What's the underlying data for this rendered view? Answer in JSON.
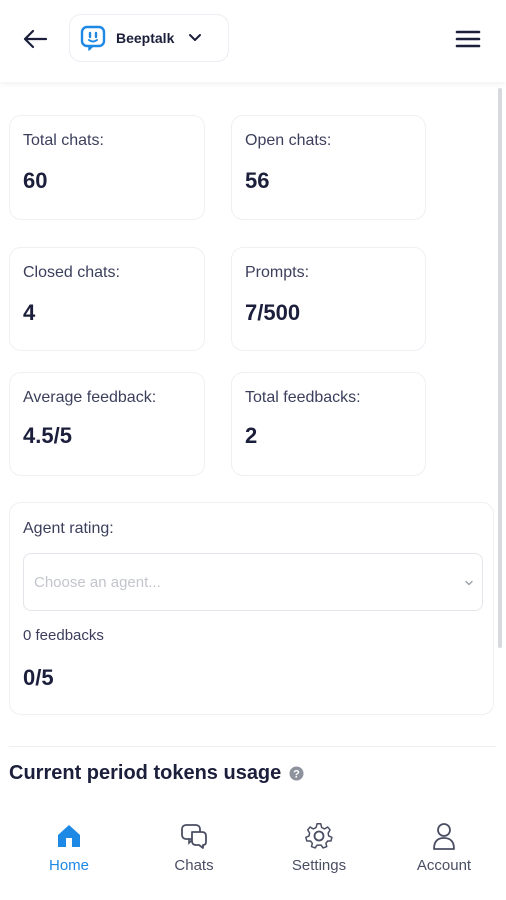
{
  "header": {
    "workspace_name": "Beeptalk"
  },
  "stats": [
    {
      "label": "Total chats:",
      "value": "60"
    },
    {
      "label": "Open chats:",
      "value": "56"
    },
    {
      "label": "Closed chats:",
      "value": "4"
    },
    {
      "label": "Prompts:",
      "value": "7/500"
    },
    {
      "label": "Average feedback:",
      "value": "4.5/5"
    },
    {
      "label": "Total feedbacks:",
      "value": "2"
    }
  ],
  "agent_rating": {
    "label": "Agent rating:",
    "select_placeholder": "Choose an agent...",
    "feedbacks_text": "0 feedbacks",
    "score": "0/5"
  },
  "tokens_section": {
    "title": "Current period tokens usage"
  },
  "nav": {
    "items": [
      {
        "label": "Home",
        "icon": "home-icon",
        "active": true
      },
      {
        "label": "Chats",
        "icon": "chats-icon",
        "active": false
      },
      {
        "label": "Settings",
        "icon": "settings-icon",
        "active": false
      },
      {
        "label": "Account",
        "icon": "account-icon",
        "active": false
      }
    ]
  },
  "colors": {
    "accent": "#1e88e5",
    "text": "#1b1f3b"
  }
}
